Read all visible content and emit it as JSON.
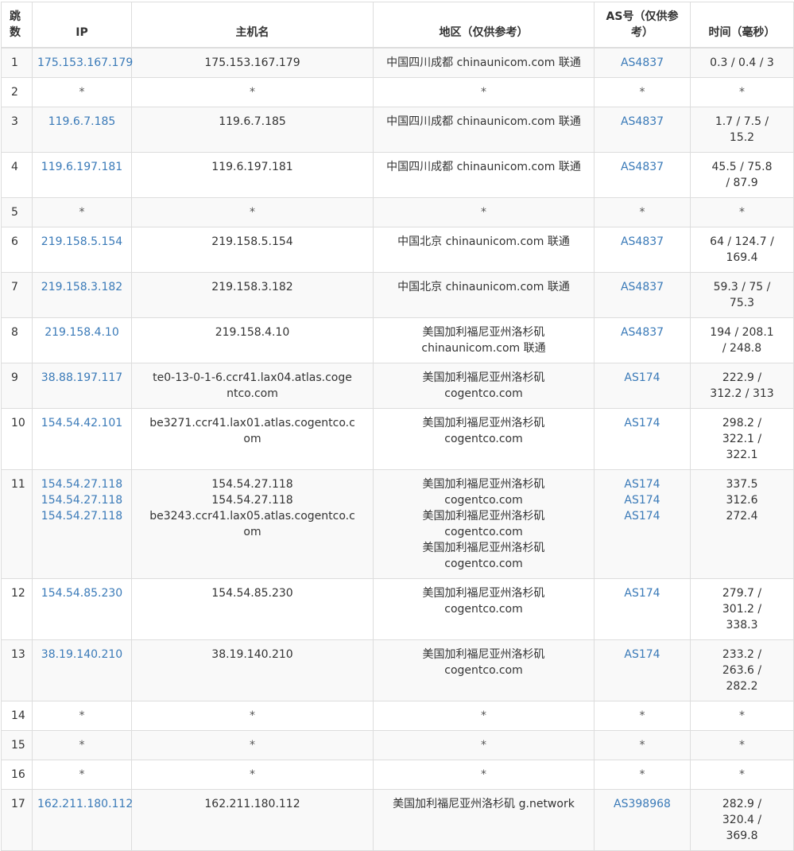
{
  "headers": {
    "hop": "跳数",
    "ip": "IP",
    "host": "主机名",
    "region": "地区（仅供参考）",
    "as": "AS号（仅供参考）",
    "time": "时间（毫秒）"
  },
  "rows": [
    {
      "hop": "1",
      "ip": "175.153.167.179",
      "host": "175.153.167.179",
      "region": "中国四川成都 chinaunicom.com 联通",
      "as": "AS4837",
      "time": "0.3 / 0.4 / 3"
    },
    {
      "hop": "2",
      "ip": "*",
      "host": "*",
      "region": "*",
      "as": "*",
      "time": "*"
    },
    {
      "hop": "3",
      "ip": "119.6.7.185",
      "host": "119.6.7.185",
      "region": "中国四川成都 chinaunicom.com 联通",
      "as": "AS4837",
      "time": "1.7 / 7.5 / 15.2"
    },
    {
      "hop": "4",
      "ip": "119.6.197.181",
      "host": "119.6.197.181",
      "region": "中国四川成都 chinaunicom.com 联通",
      "as": "AS4837",
      "time": "45.5 / 75.8 / 87.9"
    },
    {
      "hop": "5",
      "ip": "*",
      "host": "*",
      "region": "*",
      "as": "*",
      "time": "*"
    },
    {
      "hop": "6",
      "ip": "219.158.5.154",
      "host": "219.158.5.154",
      "region": "中国北京 chinaunicom.com 联通",
      "as": "AS4837",
      "time": "64 / 124.7 / 169.4"
    },
    {
      "hop": "7",
      "ip": "219.158.3.182",
      "host": "219.158.3.182",
      "region": "中国北京 chinaunicom.com 联通",
      "as": "AS4837",
      "time": "59.3 / 75 / 75.3"
    },
    {
      "hop": "8",
      "ip": "219.158.4.10",
      "host": "219.158.4.10",
      "region": "美国加利福尼亚州洛杉矶 chinaunicom.com 联通",
      "as": "AS4837",
      "time": "194 / 208.1 / 248.8"
    },
    {
      "hop": "9",
      "ip": "38.88.197.117",
      "host": "te0-13-0-1-6.ccr41.lax04.atlas.cogentco.com",
      "region": "美国加利福尼亚州洛杉矶 cogentco.com",
      "as": "AS174",
      "time": "222.9 / 312.2 / 313"
    },
    {
      "hop": "10",
      "ip": "154.54.42.101",
      "host": "be3271.ccr41.lax01.atlas.cogentco.com",
      "region": "美国加利福尼亚州洛杉矶 cogentco.com",
      "as": "AS174",
      "time": "298.2 / 322.1 / 322.1"
    },
    {
      "hop": "11",
      "ip": [
        "154.54.27.118",
        "154.54.27.118",
        "154.54.27.118"
      ],
      "host": [
        "154.54.27.118",
        "154.54.27.118",
        "be3243.ccr41.lax05.atlas.cogentco.com"
      ],
      "region": [
        "美国加利福尼亚州洛杉矶 cogentco.com",
        "美国加利福尼亚州洛杉矶 cogentco.com",
        "美国加利福尼亚州洛杉矶 cogentco.com"
      ],
      "as": [
        "AS174",
        "AS174",
        "AS174"
      ],
      "time": [
        "337.5",
        "312.6",
        "272.4"
      ]
    },
    {
      "hop": "12",
      "ip": "154.54.85.230",
      "host": "154.54.85.230",
      "region": "美国加利福尼亚州洛杉矶 cogentco.com",
      "as": "AS174",
      "time": "279.7 / 301.2 / 338.3"
    },
    {
      "hop": "13",
      "ip": "38.19.140.210",
      "host": "38.19.140.210",
      "region": "美国加利福尼亚州洛杉矶 cogentco.com",
      "as": "AS174",
      "time": "233.2 / 263.6 / 282.2"
    },
    {
      "hop": "14",
      "ip": "*",
      "host": "*",
      "region": "*",
      "as": "*",
      "time": "*"
    },
    {
      "hop": "15",
      "ip": "*",
      "host": "*",
      "region": "*",
      "as": "*",
      "time": "*"
    },
    {
      "hop": "16",
      "ip": "*",
      "host": "*",
      "region": "*",
      "as": "*",
      "time": "*"
    },
    {
      "hop": "17",
      "ip": "162.211.180.112",
      "host": "162.211.180.112",
      "region": "美国加利福尼亚州洛杉矶 g.network",
      "as": "AS398968",
      "time": "282.9 / 320.4 / 369.8"
    }
  ],
  "colors": {
    "link": "#3a7ab8",
    "border": "#dddddd",
    "stripe": "#f9f9f9"
  }
}
